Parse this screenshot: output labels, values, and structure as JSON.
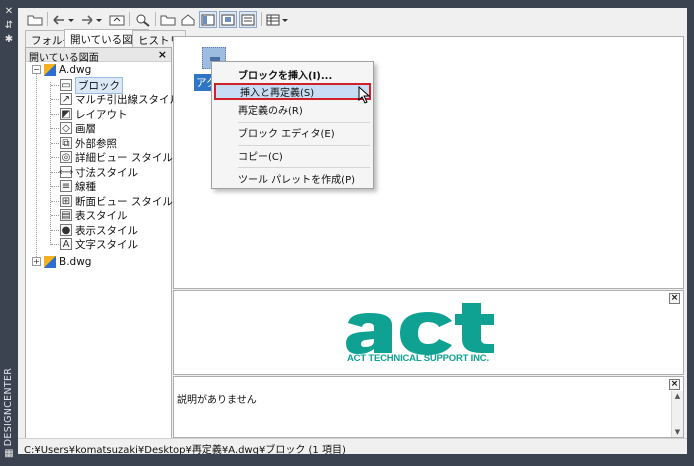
{
  "palette": {
    "title": "DESIGNCENTER",
    "icons": [
      "close-icon",
      "autohide-icon",
      "properties-icon",
      "palette-icon"
    ]
  },
  "toolbar": {
    "buttons": [
      "load-icon",
      "back-icon",
      "forward-icon",
      "up-icon",
      "search-icon",
      "favorites-icon",
      "home-icon",
      "tree-view-icon",
      "preview-icon",
      "description-icon",
      "views-icon"
    ]
  },
  "tabs": [
    {
      "label": "フォルダ",
      "active": false
    },
    {
      "label": "開いている図面",
      "active": true
    },
    {
      "label": "ヒストリ",
      "active": false
    }
  ],
  "tree": {
    "header": "開いている図面",
    "close": "×",
    "root_a": "A.dwg",
    "root_b": "B.dwg",
    "items": [
      {
        "label": "ブロック",
        "icon": "block-icon",
        "selected": true
      },
      {
        "label": "マルチ引出線スタイル",
        "icon": "multileader-icon"
      },
      {
        "label": "レイアウト",
        "icon": "layout-icon"
      },
      {
        "label": "画層",
        "icon": "layer-icon"
      },
      {
        "label": "外部参照",
        "icon": "xref-icon"
      },
      {
        "label": "詳細ビュー スタイル",
        "icon": "detail-view-icon"
      },
      {
        "label": "寸法スタイル",
        "icon": "dimension-icon"
      },
      {
        "label": "線種",
        "icon": "linetype-icon"
      },
      {
        "label": "断面ビュー スタイル",
        "icon": "section-view-icon"
      },
      {
        "label": "表スタイル",
        "icon": "table-style-icon"
      },
      {
        "label": "表示スタイル",
        "icon": "visual-style-icon"
      },
      {
        "label": "文字スタイル",
        "icon": "text-style-icon"
      }
    ]
  },
  "content": {
    "block_label": "アク"
  },
  "context_menu": {
    "items": [
      {
        "label": "ブロックを挿入(I)...",
        "bold": true
      },
      {
        "label": "挿入と再定義(S)",
        "highlighted": true
      },
      {
        "label": "再定義のみ(R)"
      },
      {
        "label": "ブロック エディタ(E)"
      },
      {
        "label": "コピー(C)"
      },
      {
        "label": "ツール パレットを作成(P)"
      }
    ]
  },
  "preview": {
    "logo_text": "ACT TECHNICAL SUPPORT INC.",
    "close": "×"
  },
  "description": {
    "text": "説明がありません",
    "close": "×"
  },
  "status": {
    "path": "C:¥Users¥komatsuzaki¥Desktop¥再定義¥A.dwg¥ブロック (1 項目)"
  },
  "colors": {
    "frame": "#3b4350",
    "logo": "#0fa191",
    "selection": "#2e75c5",
    "highlight_border": "#d0202a"
  }
}
